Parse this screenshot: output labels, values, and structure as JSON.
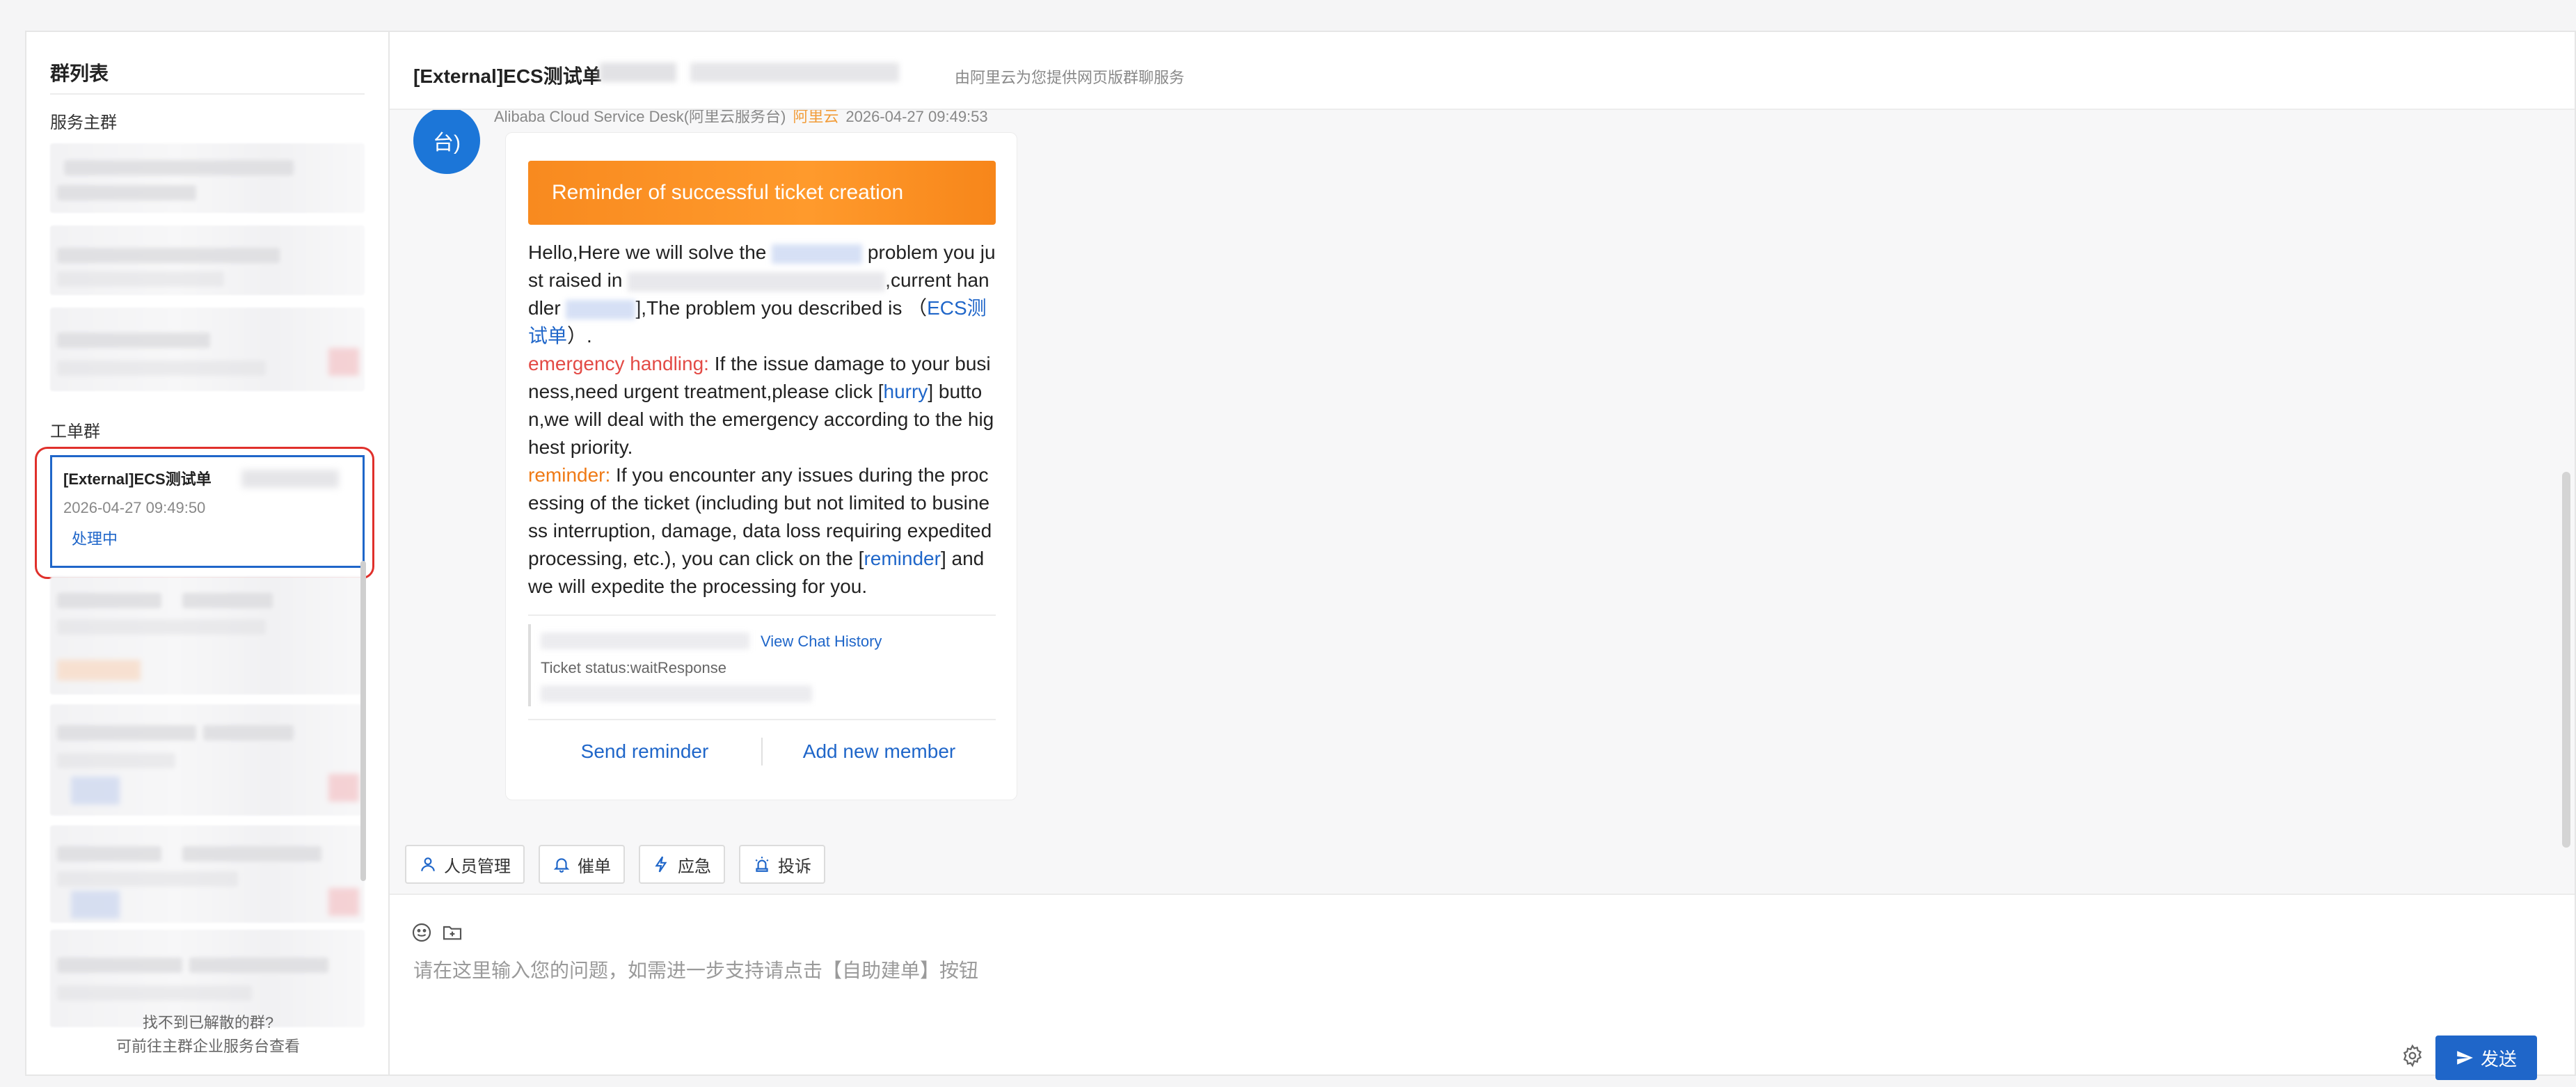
{
  "sidebar": {
    "title": "群列表",
    "service_section": "服务主群",
    "ticket_section": "工单群",
    "active_group": {
      "title": "[External]ECS测试单",
      "time": "2026-04-27 09:49:50",
      "status": "处理中"
    },
    "footer_line1": "找不到已解散的群?",
    "footer_line2": "可前往主群企业服务台查看"
  },
  "header": {
    "title": "[External]ECS测试单",
    "subtitle": "由阿里云为您提供网页版群聊服务"
  },
  "message": {
    "avatar_text": "台)",
    "sender": "Alibaba Cloud Service Desk(阿里云服务台)",
    "sender_tag": "阿里云",
    "time": "2026-04-27 09:49:53",
    "banner": "Reminder of successful ticket creation",
    "p1_a": " Hello,Here we will solve the ",
    "p1_b": " problem you just raised in ",
    "p1_c": ",current handler ",
    "p1_d": "],The problem you described is （",
    "p1_link": "ECS测试单",
    "p1_e": "）.",
    "emergency_label": "emergency handling:",
    "emergency_a": " If the issue damage to your business,need urgent treatment,please click [",
    "emergency_link": "hurry",
    "emergency_b": "] button,we will deal with the emergency according to the highest priority.",
    "reminder_label": "reminder:",
    "reminder_a": " If you encounter any issues during the processing of the ticket (including but not limited to business interruption, damage, data loss requiring expedited processing, etc.), you can click on the [",
    "reminder_link": "reminder",
    "reminder_b": "] and we will expedite the processing for you.",
    "view_history": "View Chat History",
    "ticket_status": "Ticket status:waitResponse",
    "action_send_reminder": "Send reminder",
    "action_add_member": "Add new member"
  },
  "toolbar": {
    "members": "人员管理",
    "urge": "催单",
    "emergency": "应急",
    "complaint": "投诉"
  },
  "composer": {
    "placeholder": "请在这里输入您的问题，如需进一步支持请点击【自助建单】按钮",
    "send": "发送"
  },
  "colors": {
    "accent": "#1f66c9",
    "banner": "#f88a1f",
    "highlight": "#e0302b",
    "emergency": "#e34a45",
    "reminder": "#ef7a16"
  }
}
